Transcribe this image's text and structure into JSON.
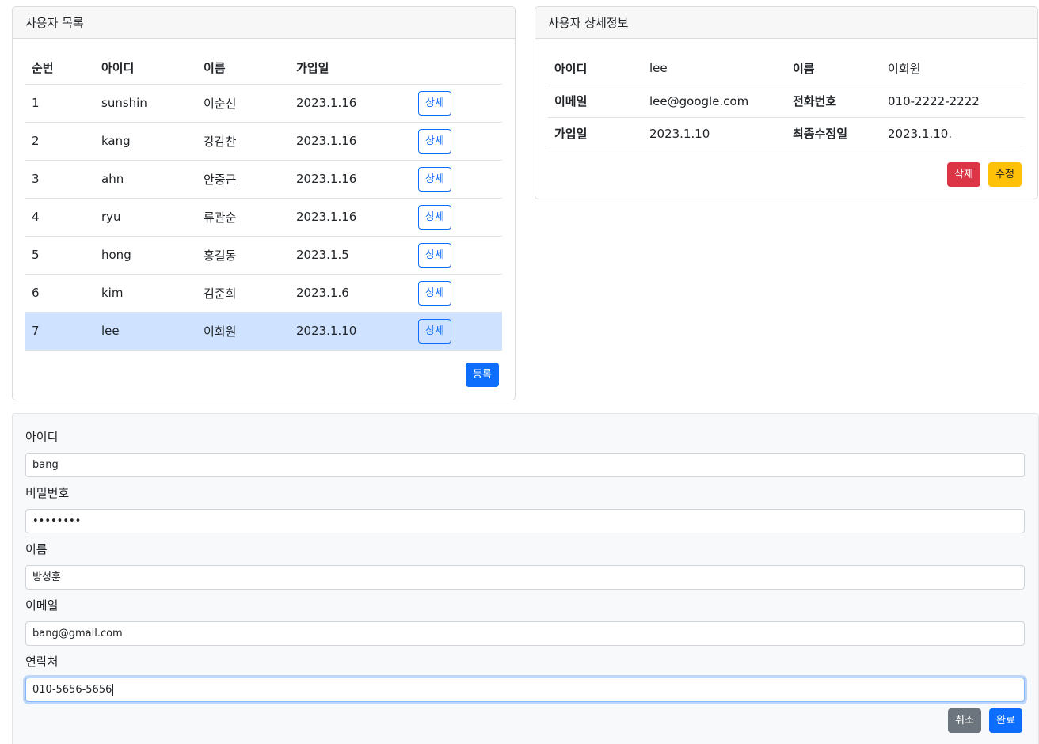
{
  "list": {
    "title": "사용자 목록",
    "columns": [
      "순번",
      "아이디",
      "이름",
      "가입일"
    ],
    "rows": [
      {
        "no": "1",
        "id": "sunshin",
        "name": "이순신",
        "date": "2023.1.16"
      },
      {
        "no": "2",
        "id": "kang",
        "name": "강감찬",
        "date": "2023.1.16"
      },
      {
        "no": "3",
        "id": "ahn",
        "name": "안중근",
        "date": "2023.1.16"
      },
      {
        "no": "4",
        "id": "ryu",
        "name": "류관순",
        "date": "2023.1.16"
      },
      {
        "no": "5",
        "id": "hong",
        "name": "홍길동",
        "date": "2023.1.5"
      },
      {
        "no": "6",
        "id": "kim",
        "name": "김준희",
        "date": "2023.1.6"
      },
      {
        "no": "7",
        "id": "lee",
        "name": "이회원",
        "date": "2023.1.10"
      }
    ],
    "selected_index": 6,
    "detail_button_label": "상세",
    "register_label": "등록"
  },
  "detail": {
    "title": "사용자 상세정보",
    "id_label": "아이디",
    "id_value": "lee",
    "name_label": "이름",
    "name_value": "이회원",
    "email_label": "이메일",
    "email_value": "lee@google.com",
    "phone_label": "전화번호",
    "phone_value": "010-2222-2222",
    "joined_label": "가입일",
    "joined_value": "2023.1.10",
    "modified_label": "최종수정일",
    "modified_value": "2023.1.10.",
    "delete_label": "삭제",
    "edit_label": "수정"
  },
  "form": {
    "id_label": "아이디",
    "id_value": "bang",
    "password_label": "비밀번호",
    "password_value": "••••••••",
    "name_label": "이름",
    "name_value": "방성훈",
    "email_label": "이메일",
    "email_value": "bang@gmail.com",
    "contact_label": "연락처",
    "contact_value": "010-5656-5656",
    "cancel_label": "취소",
    "done_label": "완료"
  },
  "colors": {
    "primary": "#0d6efd",
    "danger": "#dc3545",
    "warning": "#ffc107",
    "secondary": "#6c757d",
    "selected_row": "#cfe2ff"
  }
}
